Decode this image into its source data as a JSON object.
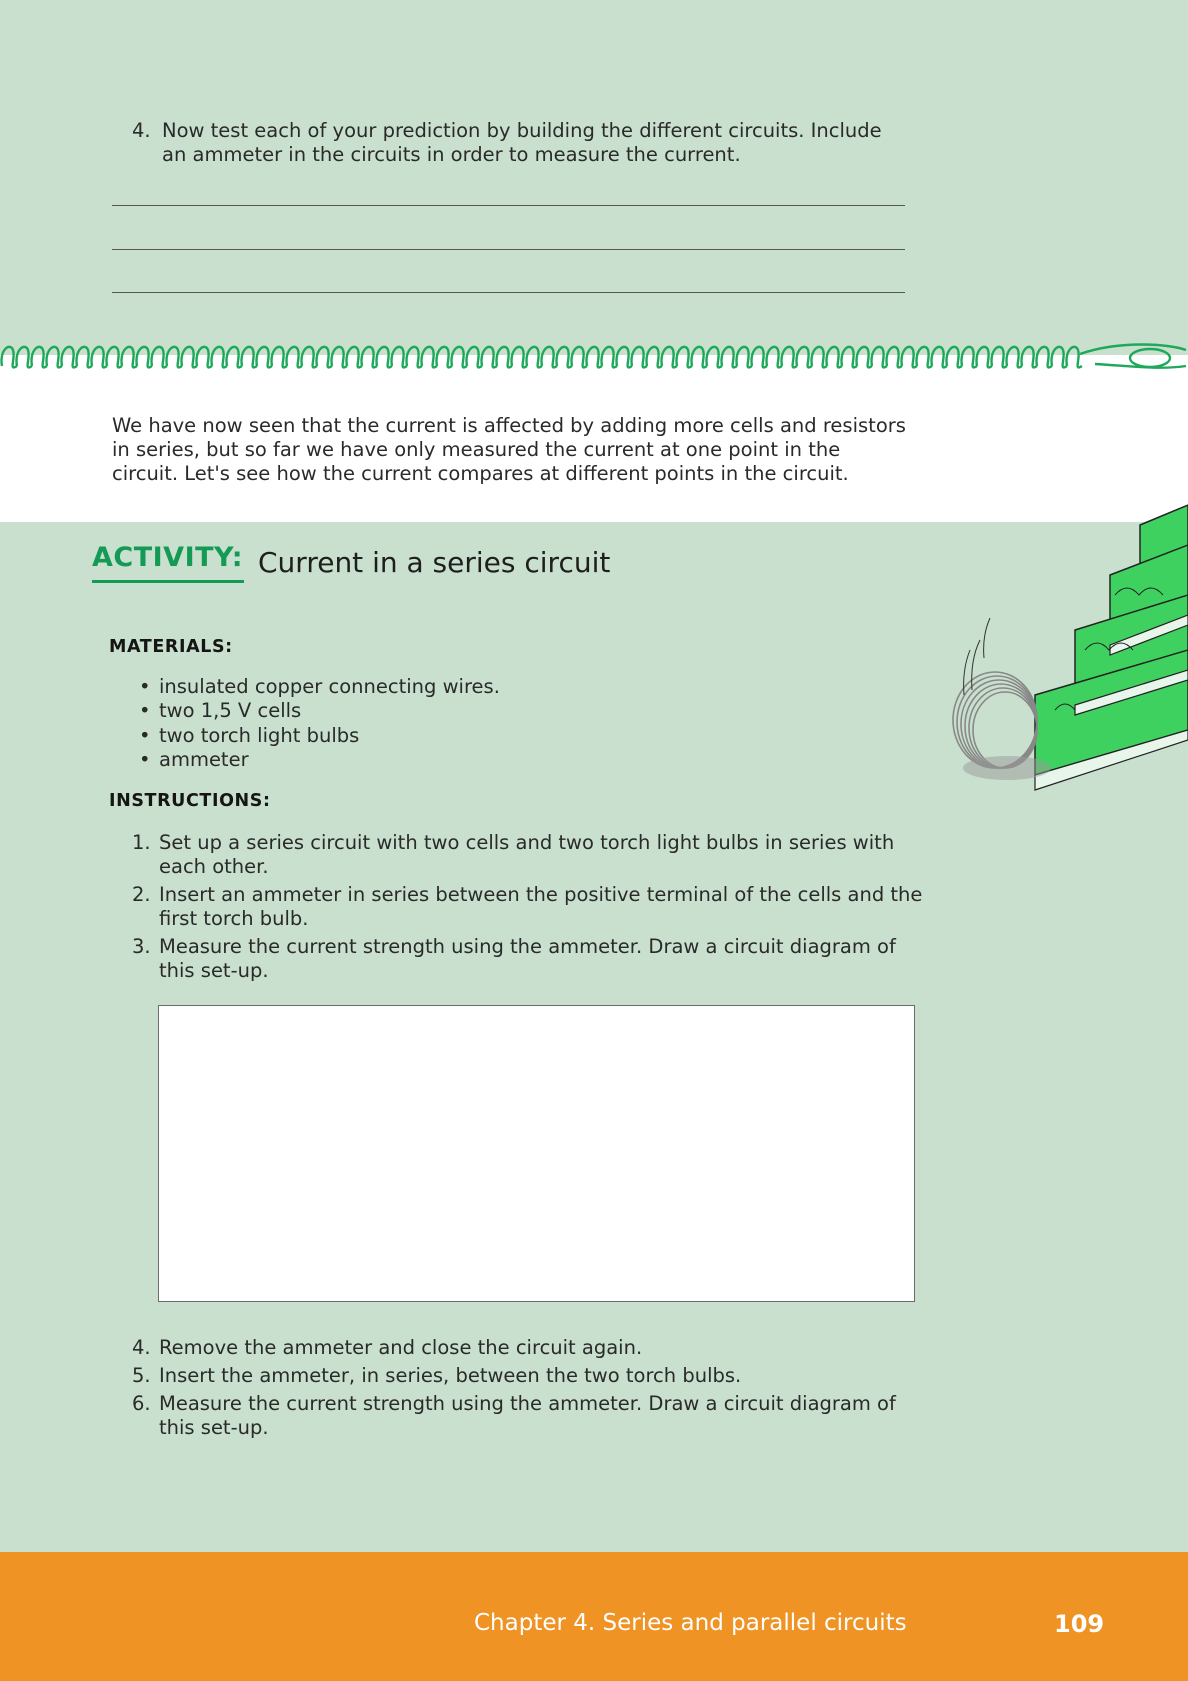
{
  "question4": {
    "number": "4.",
    "text": "Now test each of your prediction by building the different circuits. Include an ammeter in the circuits in order to measure the current."
  },
  "intro": {
    "text": "We have now seen that the current is affected by adding more cells and resistors in series, but so far we have only measured the current at one point in the circuit. Let's see how the current compares at different points in the circuit."
  },
  "activity": {
    "label": "ACTIVITY:",
    "title": "Current in a series circuit"
  },
  "materials": {
    "heading": "MATERIALS:",
    "items": [
      "insulated copper connecting wires.",
      "two 1,5 V cells",
      "two torch light bulbs",
      "ammeter"
    ]
  },
  "instructions": {
    "heading": "INSTRUCTIONS:",
    "steps": [
      {
        "number": "1.",
        "text": "Set up a series circuit with two cells and two torch light bulbs in series with each other."
      },
      {
        "number": "2.",
        "text": "Insert an ammeter in series between the positive terminal of the cells and the first torch bulb."
      },
      {
        "number": "3.",
        "text": "Measure the current strength using the ammeter. Draw a circuit diagram of this set-up."
      },
      {
        "number": "4.",
        "text": "Remove the ammeter and close the circuit again."
      },
      {
        "number": "5.",
        "text": "Insert the ammeter, in series, between the two torch bulbs."
      },
      {
        "number": "6.",
        "text": "Measure the current strength using the ammeter. Draw a circuit diagram of this set-up."
      }
    ]
  },
  "footer": {
    "chapter": "Chapter 4.   Series and parallel circuits",
    "page": "109"
  },
  "colors": {
    "page_background": "#c8e0cd",
    "accent_green": "#149a55",
    "footer_orange": "#ee9324"
  },
  "icons": {
    "divider": "spring-coil-divider",
    "illustration": "slinky-on-stairs-illustration"
  }
}
